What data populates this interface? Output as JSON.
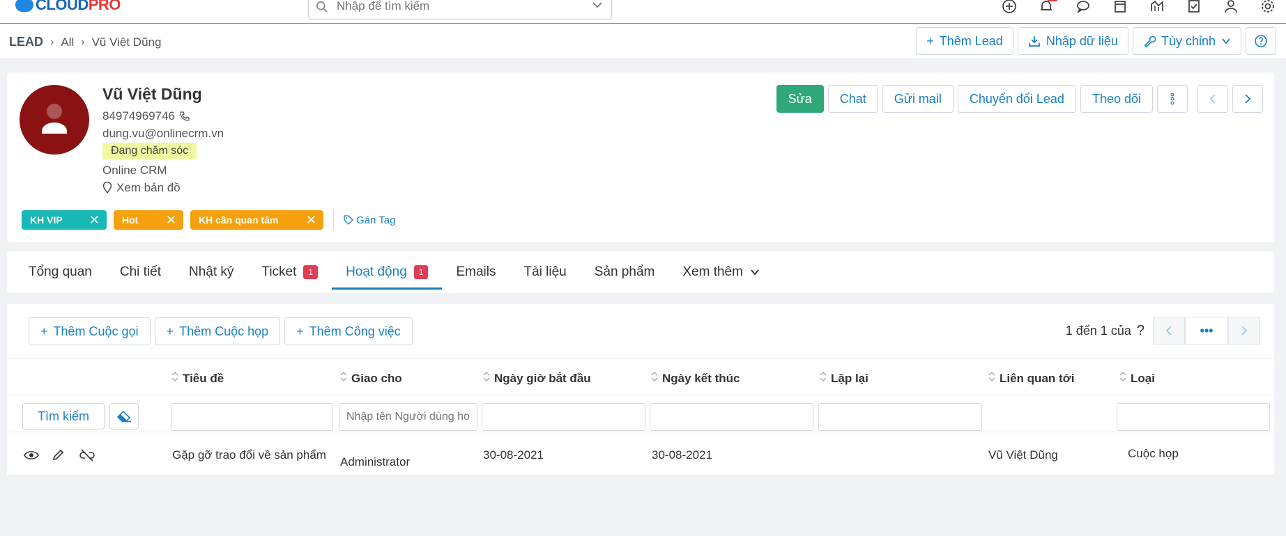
{
  "topbar": {
    "logo_main": "CLOUD",
    "logo_accent": "PRO",
    "search_placeholder": "Nhập để tìm kiếm"
  },
  "breadcrumb": {
    "root": "LEAD",
    "level1": "All",
    "current": "Vũ Việt Dũng"
  },
  "header_actions": {
    "add_lead": "Thêm Lead",
    "import": "Nhập dữ liệu",
    "customize": "Tùy chỉnh"
  },
  "profile": {
    "name": "Vũ Việt Dũng",
    "phone": "84974969746",
    "email": "dung.vu@onlinecrm.vn",
    "status": "Đang chăm sóc",
    "company": "Online CRM",
    "map_link": "Xem bản đồ",
    "tags": [
      "KH VIP",
      "Hot",
      "KH cần quan tâm"
    ],
    "assign_tag": "Gán Tag",
    "actions": {
      "edit": "Sửa",
      "chat": "Chat",
      "send_mail": "Gửi mail",
      "convert": "Chuyển đổi Lead",
      "follow": "Theo dõi"
    }
  },
  "tabs": [
    {
      "label": "Tổng quan"
    },
    {
      "label": "Chi tiết"
    },
    {
      "label": "Nhật ký"
    },
    {
      "label": "Ticket",
      "badge": "1"
    },
    {
      "label": "Hoạt động",
      "badge": "1"
    },
    {
      "label": "Emails"
    },
    {
      "label": "Tài liệu"
    },
    {
      "label": "Sản phẩm"
    },
    {
      "label": "Xem thêm"
    }
  ],
  "activities": {
    "add_call": "Thêm Cuộc gọi",
    "add_meeting": "Thêm Cuộc họp",
    "add_task": "Thêm Công việc",
    "pager_text": "1 đến 1 của",
    "pager_q": "?",
    "pager_more": "•••",
    "columns": [
      "Tiêu đề",
      "Giao cho",
      "Ngày giờ bắt đầu",
      "Ngày kết thúc",
      "Lặp lại",
      "Liên quan tới",
      "Loại"
    ],
    "search_button": "Tìm kiếm",
    "assignee_placeholder": "Nhập tên Người dùng hoặc Nhóm",
    "rows": [
      {
        "title": "Gặp gỡ trao đổi về sản phẩm",
        "assignee": "Administrator",
        "start": "30-08-2021",
        "end": "30-08-2021",
        "repeat": "",
        "related": "Vũ Việt Dũng",
        "type": "Cuộc họp"
      }
    ]
  },
  "colors": {
    "primary": "#1a7fc1",
    "success": "#2fa97a",
    "avatar_bg": "#8b1212",
    "tag_teal": "#17b8b6",
    "tag_orange": "#f5a10f",
    "badge_red": "#e13c54",
    "status_bg": "#eef9a0"
  }
}
